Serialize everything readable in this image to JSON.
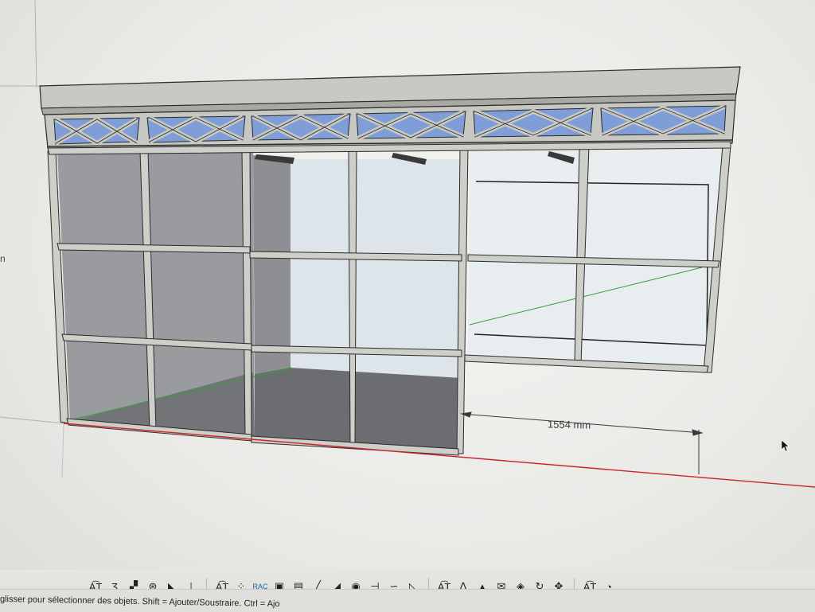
{
  "viewport": {
    "dimension_label": "1554 mm",
    "side_letter": "n"
  },
  "toolbar": {
    "tools": [
      {
        "name": "text-tool",
        "glyph": "A͡T"
      },
      {
        "name": "dimension-tool",
        "glyph": "Ʒ"
      },
      {
        "name": "section-tool",
        "glyph": "▞"
      },
      {
        "name": "protractor-tool",
        "glyph": "⊛"
      },
      {
        "name": "stairs-tool",
        "glyph": "◣"
      },
      {
        "name": "axes-tool",
        "glyph": "⊥"
      },
      {
        "name": "sep"
      },
      {
        "name": "text-tool-2",
        "glyph": "A͡T"
      },
      {
        "name": "dots-tool",
        "glyph": "⁘"
      },
      {
        "name": "rac-label",
        "glyph": "RAC"
      },
      {
        "name": "group-tool",
        "glyph": "▣"
      },
      {
        "name": "component-tool",
        "glyph": "▤"
      },
      {
        "name": "pencil-tool",
        "glyph": "╱"
      },
      {
        "name": "paint-tool",
        "glyph": "◢"
      },
      {
        "name": "target-tool",
        "glyph": "◉"
      },
      {
        "name": "align-tool",
        "glyph": "⊣"
      },
      {
        "name": "curve-tool",
        "glyph": "∽"
      },
      {
        "name": "triangle-tool",
        "glyph": "◺"
      },
      {
        "name": "sep"
      },
      {
        "name": "text-tool-3",
        "glyph": "A͡T"
      },
      {
        "name": "sandbox-tool",
        "glyph": "⋀"
      },
      {
        "name": "color-tool",
        "glyph": "▲"
      },
      {
        "name": "mail-tool",
        "glyph": "✉"
      },
      {
        "name": "paint-bucket-tool",
        "glyph": "◈"
      },
      {
        "name": "orbit-tool",
        "glyph": "↻"
      },
      {
        "name": "move-tool",
        "glyph": "✥"
      },
      {
        "name": "sep"
      },
      {
        "name": "text-tool-4",
        "glyph": "A͡T"
      },
      {
        "name": "last-tool",
        "glyph": "◔"
      }
    ]
  },
  "status_bar": {
    "text": "glisser pour sélectionner des objets. Shift = Ajouter/Soustraire. Ctrl = Ajo"
  },
  "colors": {
    "frame": "#c8c8c2",
    "frame_edge": "#2a2a2a",
    "glass_light": "#e2e9ee",
    "glass_blue": "#7f9ed8",
    "floor": "#707073",
    "red_axis": "#c8222a",
    "green_axis": "#3a9a3a"
  }
}
